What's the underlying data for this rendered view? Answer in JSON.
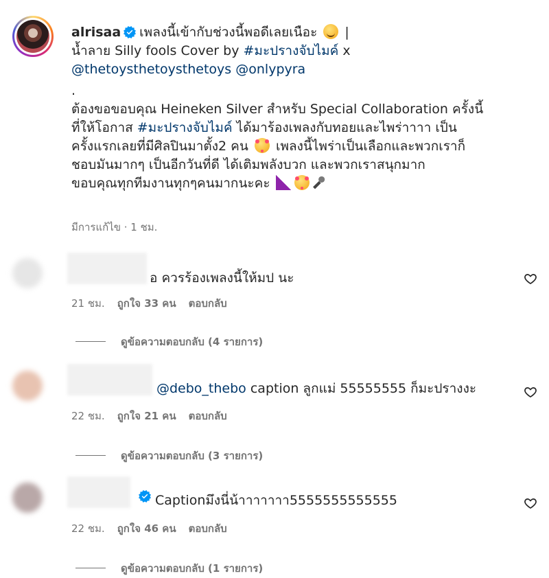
{
  "post": {
    "username": "alrisaa",
    "caption_lines": [
      "เพลงนี้เข้ากับช่วงนี้พอดีเลยเนือะ",
      "น้ำลาย Silly fools Cover by ",
      "#มะปรางจับไมค์",
      " x",
      "@thetoysthetoysthetoys",
      "@onlypyra",
      ".",
      "ต้องขอขอบคุณ Heineken Silver สำหรับ Special Collaboration ครั้งนี้",
      "ที่ให้โอกาส ",
      "#มะปรางจับไมค์",
      " ได้มาร้องเพลงกับทอยและไพร่าาาา เป็น",
      "ครั้งแรกเลยที่มีศิลปินมาตั้ง2 คน",
      " เพลงนี้ไพร่าเป็นเลือกและพวกเราก็",
      "ชอบมันมากๆ เป็นอีกวันที่ดี ได้เติมพลังบวก และพวกเราสนุกมาก",
      "ขอบคุณทุกทีมงานทุกๆคนมากนะคะ"
    ],
    "bar": "|",
    "edited_meta": "มีการแก้ไข · 1 ชม."
  },
  "comments": [
    {
      "text": "อ ควรร้องเพลงนี้ให้มป นะ",
      "time": "21 ชม.",
      "likes": "ถูกใจ 33 คน",
      "reply": "ตอบกลับ",
      "view_replies": "ดูข้อความตอบกลับ (4 รายการ)"
    },
    {
      "mention": "@debo_thebo",
      "text": " caption ลูกแม่ 55555555 ก็มะปรางงะ",
      "time": "22 ชม.",
      "likes": "ถูกใจ 21 คน",
      "reply": "ตอบกลับ",
      "view_replies": "ดูข้อความตอบกลับ (3 รายการ)"
    },
    {
      "text": "Captionมึงนี่น้าาาาาาา5555555555555",
      "time": "22 ชม.",
      "likes": "ถูกใจ 46 คน",
      "reply": "ตอบกลับ",
      "view_replies": "ดูข้อความตอบกลับ (1 รายการ)"
    }
  ],
  "colors": {
    "text": "#262626",
    "secondary": "#737373",
    "link": "#00376b",
    "verified": "#0095f6"
  },
  "icons": [
    "verified-badge-icon",
    "heart-icon",
    "rainbow-emoji",
    "heart-eyes-emoji",
    "smile-emoji",
    "microphone-emoji"
  ]
}
